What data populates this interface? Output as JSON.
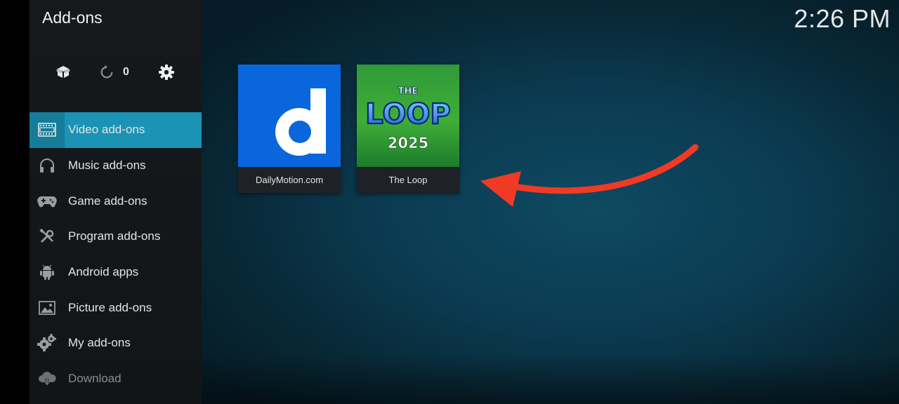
{
  "header": {
    "title": "Add-ons",
    "clock": "2:26 PM"
  },
  "toolbar": {
    "update_count": "0"
  },
  "sidebar": {
    "items": [
      {
        "label": "Video add-ons",
        "icon": "film-icon"
      },
      {
        "label": "Music add-ons",
        "icon": "headphones-icon"
      },
      {
        "label": "Game add-ons",
        "icon": "gamepad-icon"
      },
      {
        "label": "Program add-ons",
        "icon": "tools-icon"
      },
      {
        "label": "Android apps",
        "icon": "android-icon"
      },
      {
        "label": "Picture add-ons",
        "icon": "picture-icon"
      },
      {
        "label": "My add-ons",
        "icon": "gears-icon"
      },
      {
        "label": "Download",
        "icon": "cloud-download-icon"
      }
    ]
  },
  "tiles": [
    {
      "caption": "DailyMotion.com",
      "logo_text": "d",
      "color": "#0a66dc"
    },
    {
      "caption": "The Loop",
      "logo_top": "THE",
      "logo_main": "LOOP",
      "logo_year": "2025"
    }
  ],
  "colors": {
    "accent": "#1b93b5",
    "arrow": "#f03a24"
  }
}
